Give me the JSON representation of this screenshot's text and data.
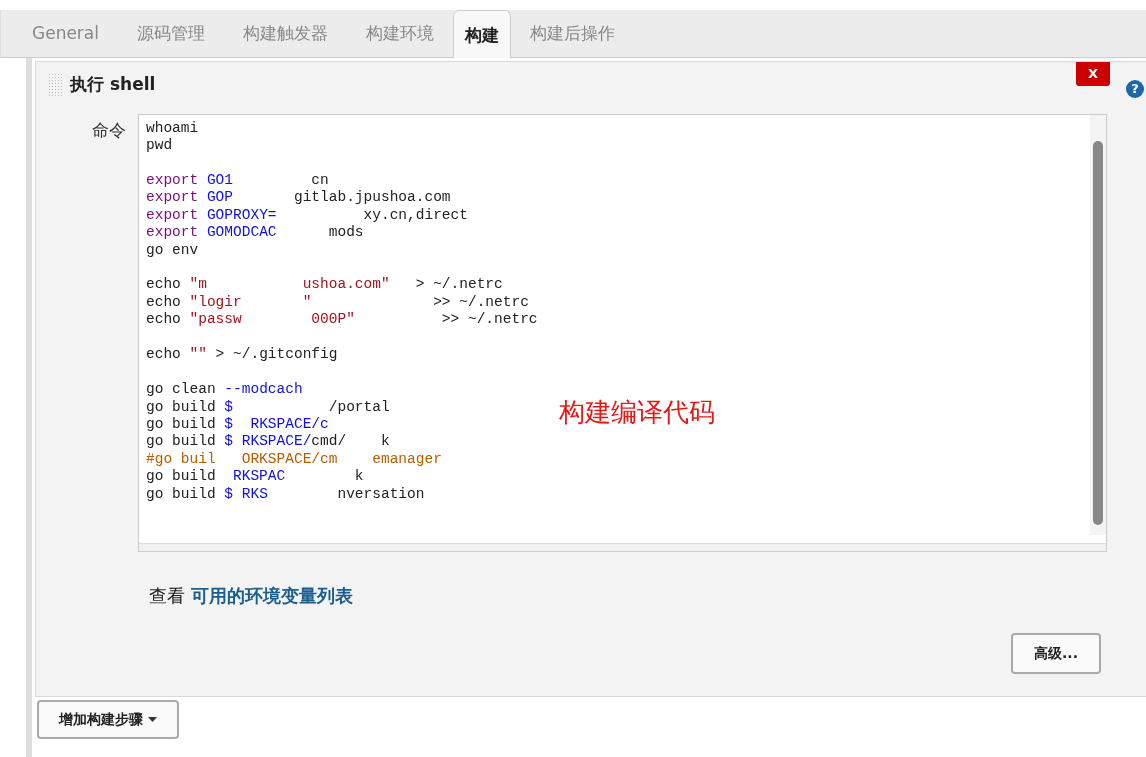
{
  "tabs": [
    {
      "label": "General",
      "selected": false
    },
    {
      "label": "源码管理",
      "selected": false
    },
    {
      "label": "构建触发器",
      "selected": false
    },
    {
      "label": "构建环境",
      "selected": false
    },
    {
      "label": "构建",
      "selected": true
    },
    {
      "label": "构建后操作",
      "selected": false
    }
  ],
  "step": {
    "title": "执行 shell",
    "delete_label": "X",
    "help_label": "?",
    "command_label": "命令",
    "code": [
      {
        "kind": "code",
        "segments": [
          {
            "kind": "plain",
            "text": "whoami"
          }
        ]
      },
      {
        "kind": "code",
        "segments": [
          {
            "kind": "plain",
            "text": "pwd"
          }
        ]
      },
      {
        "kind": "blank"
      },
      {
        "kind": "code",
        "segments": [
          {
            "kind": "keyword",
            "text": "export "
          },
          {
            "kind": "variable",
            "text": "GO1"
          },
          {
            "kind": "plain",
            "text": "         cn"
          }
        ]
      },
      {
        "kind": "code",
        "segments": [
          {
            "kind": "keyword",
            "text": "export "
          },
          {
            "kind": "variable",
            "text": "GOP"
          },
          {
            "kind": "plain",
            "text": "       gitlab.jpushoa.com"
          }
        ]
      },
      {
        "kind": "code",
        "segments": [
          {
            "kind": "keyword",
            "text": "export "
          },
          {
            "kind": "variable",
            "text": "GOPROXY="
          },
          {
            "kind": "plain",
            "text": "          xy.cn,direct"
          }
        ]
      },
      {
        "kind": "code",
        "segments": [
          {
            "kind": "keyword",
            "text": "export "
          },
          {
            "kind": "variable",
            "text": "GOMODCAC"
          },
          {
            "kind": "plain",
            "text": "      mods"
          }
        ]
      },
      {
        "kind": "code",
        "segments": [
          {
            "kind": "plain",
            "text": "go env"
          }
        ]
      },
      {
        "kind": "blank"
      },
      {
        "kind": "code",
        "segments": [
          {
            "kind": "plain",
            "text": "echo "
          },
          {
            "kind": "string",
            "text": "\"m           ushoa.com\""
          },
          {
            "kind": "plain",
            "text": "   > ~/.netrc"
          }
        ]
      },
      {
        "kind": "code",
        "segments": [
          {
            "kind": "plain",
            "text": "echo "
          },
          {
            "kind": "string",
            "text": "\"logir       \""
          },
          {
            "kind": "plain",
            "text": "              >> ~/.netrc"
          }
        ]
      },
      {
        "kind": "code",
        "segments": [
          {
            "kind": "plain",
            "text": "echo "
          },
          {
            "kind": "string",
            "text": "\"passw        000P\""
          },
          {
            "kind": "plain",
            "text": "          >> ~/.netrc"
          }
        ]
      },
      {
        "kind": "blank"
      },
      {
        "kind": "code",
        "segments": [
          {
            "kind": "plain",
            "text": "echo "
          },
          {
            "kind": "string",
            "text": "\"\""
          },
          {
            "kind": "plain",
            "text": " > ~/.gitconfig"
          }
        ]
      },
      {
        "kind": "blank"
      },
      {
        "kind": "code",
        "segments": [
          {
            "kind": "plain",
            "text": "go clean "
          },
          {
            "kind": "variable",
            "text": "--modcach"
          }
        ]
      },
      {
        "kind": "code",
        "segments": [
          {
            "kind": "plain",
            "text": "go build "
          },
          {
            "kind": "variable",
            "text": "$"
          },
          {
            "kind": "plain",
            "text": "           /portal"
          }
        ]
      },
      {
        "kind": "code",
        "segments": [
          {
            "kind": "plain",
            "text": "go build "
          },
          {
            "kind": "variable",
            "text": "$  RKSPACE/c"
          }
        ]
      },
      {
        "kind": "code",
        "segments": [
          {
            "kind": "plain",
            "text": "go build "
          },
          {
            "kind": "variable",
            "text": "$ RKSPACE/"
          },
          {
            "kind": "plain",
            "text": "cmd/    k"
          }
        ]
      },
      {
        "kind": "code",
        "segments": [
          {
            "kind": "comment",
            "text": "#go buil   ORKSPACE/cm    emanager"
          }
        ]
      },
      {
        "kind": "code",
        "segments": [
          {
            "kind": "plain",
            "text": "go build  "
          },
          {
            "kind": "variable",
            "text": "RKSPAC"
          },
          {
            "kind": "plain",
            "text": "        k"
          }
        ]
      },
      {
        "kind": "code",
        "segments": [
          {
            "kind": "plain",
            "text": "go build "
          },
          {
            "kind": "variable",
            "text": "$ RKS"
          },
          {
            "kind": "plain",
            "text": "        nversation"
          }
        ]
      }
    ],
    "annotation": "构建编译代码",
    "env_prefix": "查看 ",
    "env_link": "可用的环境变量列表",
    "advanced_button": "高级..."
  },
  "add_step_button": "增加构建步骤"
}
